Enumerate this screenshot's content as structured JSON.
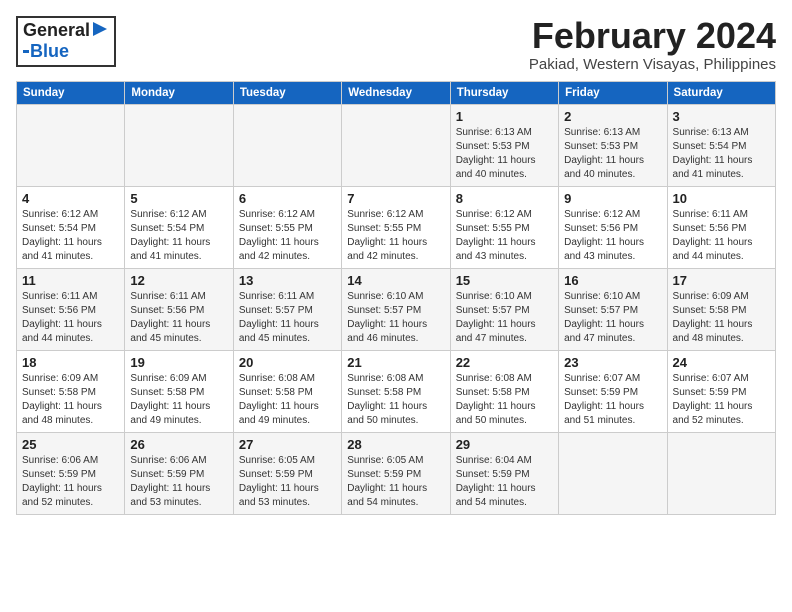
{
  "logo": {
    "text1": "General",
    "text2": "Blue"
  },
  "title": "February 2024",
  "subtitle": "Pakiad, Western Visayas, Philippines",
  "days_of_week": [
    "Sunday",
    "Monday",
    "Tuesday",
    "Wednesday",
    "Thursday",
    "Friday",
    "Saturday"
  ],
  "weeks": [
    [
      {
        "day": "",
        "info": ""
      },
      {
        "day": "",
        "info": ""
      },
      {
        "day": "",
        "info": ""
      },
      {
        "day": "",
        "info": ""
      },
      {
        "day": "1",
        "info": "Sunrise: 6:13 AM\nSunset: 5:53 PM\nDaylight: 11 hours\nand 40 minutes."
      },
      {
        "day": "2",
        "info": "Sunrise: 6:13 AM\nSunset: 5:53 PM\nDaylight: 11 hours\nand 40 minutes."
      },
      {
        "day": "3",
        "info": "Sunrise: 6:13 AM\nSunset: 5:54 PM\nDaylight: 11 hours\nand 41 minutes."
      }
    ],
    [
      {
        "day": "4",
        "info": "Sunrise: 6:12 AM\nSunset: 5:54 PM\nDaylight: 11 hours\nand 41 minutes."
      },
      {
        "day": "5",
        "info": "Sunrise: 6:12 AM\nSunset: 5:54 PM\nDaylight: 11 hours\nand 41 minutes."
      },
      {
        "day": "6",
        "info": "Sunrise: 6:12 AM\nSunset: 5:55 PM\nDaylight: 11 hours\nand 42 minutes."
      },
      {
        "day": "7",
        "info": "Sunrise: 6:12 AM\nSunset: 5:55 PM\nDaylight: 11 hours\nand 42 minutes."
      },
      {
        "day": "8",
        "info": "Sunrise: 6:12 AM\nSunset: 5:55 PM\nDaylight: 11 hours\nand 43 minutes."
      },
      {
        "day": "9",
        "info": "Sunrise: 6:12 AM\nSunset: 5:56 PM\nDaylight: 11 hours\nand 43 minutes."
      },
      {
        "day": "10",
        "info": "Sunrise: 6:11 AM\nSunset: 5:56 PM\nDaylight: 11 hours\nand 44 minutes."
      }
    ],
    [
      {
        "day": "11",
        "info": "Sunrise: 6:11 AM\nSunset: 5:56 PM\nDaylight: 11 hours\nand 44 minutes."
      },
      {
        "day": "12",
        "info": "Sunrise: 6:11 AM\nSunset: 5:56 PM\nDaylight: 11 hours\nand 45 minutes."
      },
      {
        "day": "13",
        "info": "Sunrise: 6:11 AM\nSunset: 5:57 PM\nDaylight: 11 hours\nand 45 minutes."
      },
      {
        "day": "14",
        "info": "Sunrise: 6:10 AM\nSunset: 5:57 PM\nDaylight: 11 hours\nand 46 minutes."
      },
      {
        "day": "15",
        "info": "Sunrise: 6:10 AM\nSunset: 5:57 PM\nDaylight: 11 hours\nand 47 minutes."
      },
      {
        "day": "16",
        "info": "Sunrise: 6:10 AM\nSunset: 5:57 PM\nDaylight: 11 hours\nand 47 minutes."
      },
      {
        "day": "17",
        "info": "Sunrise: 6:09 AM\nSunset: 5:58 PM\nDaylight: 11 hours\nand 48 minutes."
      }
    ],
    [
      {
        "day": "18",
        "info": "Sunrise: 6:09 AM\nSunset: 5:58 PM\nDaylight: 11 hours\nand 48 minutes."
      },
      {
        "day": "19",
        "info": "Sunrise: 6:09 AM\nSunset: 5:58 PM\nDaylight: 11 hours\nand 49 minutes."
      },
      {
        "day": "20",
        "info": "Sunrise: 6:08 AM\nSunset: 5:58 PM\nDaylight: 11 hours\nand 49 minutes."
      },
      {
        "day": "21",
        "info": "Sunrise: 6:08 AM\nSunset: 5:58 PM\nDaylight: 11 hours\nand 50 minutes."
      },
      {
        "day": "22",
        "info": "Sunrise: 6:08 AM\nSunset: 5:58 PM\nDaylight: 11 hours\nand 50 minutes."
      },
      {
        "day": "23",
        "info": "Sunrise: 6:07 AM\nSunset: 5:59 PM\nDaylight: 11 hours\nand 51 minutes."
      },
      {
        "day": "24",
        "info": "Sunrise: 6:07 AM\nSunset: 5:59 PM\nDaylight: 11 hours\nand 52 minutes."
      }
    ],
    [
      {
        "day": "25",
        "info": "Sunrise: 6:06 AM\nSunset: 5:59 PM\nDaylight: 11 hours\nand 52 minutes."
      },
      {
        "day": "26",
        "info": "Sunrise: 6:06 AM\nSunset: 5:59 PM\nDaylight: 11 hours\nand 53 minutes."
      },
      {
        "day": "27",
        "info": "Sunrise: 6:05 AM\nSunset: 5:59 PM\nDaylight: 11 hours\nand 53 minutes."
      },
      {
        "day": "28",
        "info": "Sunrise: 6:05 AM\nSunset: 5:59 PM\nDaylight: 11 hours\nand 54 minutes."
      },
      {
        "day": "29",
        "info": "Sunrise: 6:04 AM\nSunset: 5:59 PM\nDaylight: 11 hours\nand 54 minutes."
      },
      {
        "day": "",
        "info": ""
      },
      {
        "day": "",
        "info": ""
      }
    ]
  ]
}
